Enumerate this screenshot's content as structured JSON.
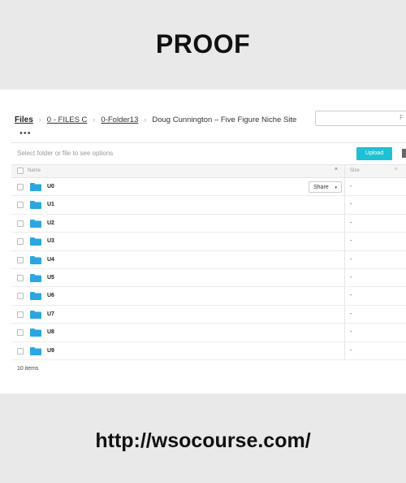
{
  "header": {
    "title": "PROOF"
  },
  "breadcrumb": {
    "root": "Files",
    "items": [
      "0 - FILES C",
      "0-Folder13"
    ],
    "current": "Doug Cunnington – Five Figure Niche Site",
    "separator": "›"
  },
  "search": {
    "placeholder": "F"
  },
  "toolbar": {
    "more": "•••",
    "hint": "Select folder or file to see options",
    "upload_label": "Upload"
  },
  "table": {
    "columns": {
      "name": "Name",
      "size": "Size"
    },
    "sort_icon": "^",
    "share_label": "Share",
    "share_caret": "▾",
    "rows": [
      {
        "name": "U0",
        "size": "-"
      },
      {
        "name": "U1",
        "size": "-"
      },
      {
        "name": "U2",
        "size": "-"
      },
      {
        "name": "U3",
        "size": "-"
      },
      {
        "name": "U4",
        "size": "-"
      },
      {
        "name": "U5",
        "size": "-"
      },
      {
        "name": "U6",
        "size": "-"
      },
      {
        "name": "U7",
        "size": "-"
      },
      {
        "name": "U8",
        "size": "-"
      },
      {
        "name": "U9",
        "size": "-"
      }
    ]
  },
  "footer": {
    "items_count": "10 items"
  },
  "watermark": {
    "url": "http://wsocourse.com/"
  },
  "colors": {
    "accent": "#1ec0d6",
    "folder": "#2aa7e1",
    "background": "#e9e9e9"
  },
  "icons": {
    "folder": "folder-icon",
    "sort": "chevron-up-icon",
    "view": "grid-view-icon"
  }
}
